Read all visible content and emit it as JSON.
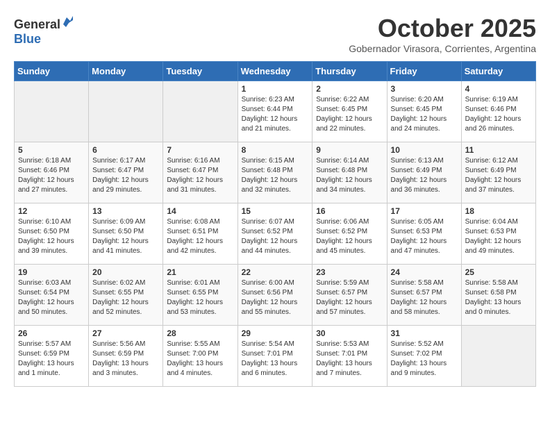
{
  "header": {
    "logo_general": "General",
    "logo_blue": "Blue",
    "month_title": "October 2025",
    "location": "Gobernador Virasora, Corrientes, Argentina"
  },
  "weekdays": [
    "Sunday",
    "Monday",
    "Tuesday",
    "Wednesday",
    "Thursday",
    "Friday",
    "Saturday"
  ],
  "weeks": [
    [
      {
        "day": "",
        "info": ""
      },
      {
        "day": "",
        "info": ""
      },
      {
        "day": "",
        "info": ""
      },
      {
        "day": "1",
        "info": "Sunrise: 6:23 AM\nSunset: 6:44 PM\nDaylight: 12 hours\nand 21 minutes."
      },
      {
        "day": "2",
        "info": "Sunrise: 6:22 AM\nSunset: 6:45 PM\nDaylight: 12 hours\nand 22 minutes."
      },
      {
        "day": "3",
        "info": "Sunrise: 6:20 AM\nSunset: 6:45 PM\nDaylight: 12 hours\nand 24 minutes."
      },
      {
        "day": "4",
        "info": "Sunrise: 6:19 AM\nSunset: 6:46 PM\nDaylight: 12 hours\nand 26 minutes."
      }
    ],
    [
      {
        "day": "5",
        "info": "Sunrise: 6:18 AM\nSunset: 6:46 PM\nDaylight: 12 hours\nand 27 minutes."
      },
      {
        "day": "6",
        "info": "Sunrise: 6:17 AM\nSunset: 6:47 PM\nDaylight: 12 hours\nand 29 minutes."
      },
      {
        "day": "7",
        "info": "Sunrise: 6:16 AM\nSunset: 6:47 PM\nDaylight: 12 hours\nand 31 minutes."
      },
      {
        "day": "8",
        "info": "Sunrise: 6:15 AM\nSunset: 6:48 PM\nDaylight: 12 hours\nand 32 minutes."
      },
      {
        "day": "9",
        "info": "Sunrise: 6:14 AM\nSunset: 6:48 PM\nDaylight: 12 hours\nand 34 minutes."
      },
      {
        "day": "10",
        "info": "Sunrise: 6:13 AM\nSunset: 6:49 PM\nDaylight: 12 hours\nand 36 minutes."
      },
      {
        "day": "11",
        "info": "Sunrise: 6:12 AM\nSunset: 6:49 PM\nDaylight: 12 hours\nand 37 minutes."
      }
    ],
    [
      {
        "day": "12",
        "info": "Sunrise: 6:10 AM\nSunset: 6:50 PM\nDaylight: 12 hours\nand 39 minutes."
      },
      {
        "day": "13",
        "info": "Sunrise: 6:09 AM\nSunset: 6:50 PM\nDaylight: 12 hours\nand 41 minutes."
      },
      {
        "day": "14",
        "info": "Sunrise: 6:08 AM\nSunset: 6:51 PM\nDaylight: 12 hours\nand 42 minutes."
      },
      {
        "day": "15",
        "info": "Sunrise: 6:07 AM\nSunset: 6:52 PM\nDaylight: 12 hours\nand 44 minutes."
      },
      {
        "day": "16",
        "info": "Sunrise: 6:06 AM\nSunset: 6:52 PM\nDaylight: 12 hours\nand 45 minutes."
      },
      {
        "day": "17",
        "info": "Sunrise: 6:05 AM\nSunset: 6:53 PM\nDaylight: 12 hours\nand 47 minutes."
      },
      {
        "day": "18",
        "info": "Sunrise: 6:04 AM\nSunset: 6:53 PM\nDaylight: 12 hours\nand 49 minutes."
      }
    ],
    [
      {
        "day": "19",
        "info": "Sunrise: 6:03 AM\nSunset: 6:54 PM\nDaylight: 12 hours\nand 50 minutes."
      },
      {
        "day": "20",
        "info": "Sunrise: 6:02 AM\nSunset: 6:55 PM\nDaylight: 12 hours\nand 52 minutes."
      },
      {
        "day": "21",
        "info": "Sunrise: 6:01 AM\nSunset: 6:55 PM\nDaylight: 12 hours\nand 53 minutes."
      },
      {
        "day": "22",
        "info": "Sunrise: 6:00 AM\nSunset: 6:56 PM\nDaylight: 12 hours\nand 55 minutes."
      },
      {
        "day": "23",
        "info": "Sunrise: 5:59 AM\nSunset: 6:57 PM\nDaylight: 12 hours\nand 57 minutes."
      },
      {
        "day": "24",
        "info": "Sunrise: 5:58 AM\nSunset: 6:57 PM\nDaylight: 12 hours\nand 58 minutes."
      },
      {
        "day": "25",
        "info": "Sunrise: 5:58 AM\nSunset: 6:58 PM\nDaylight: 13 hours\nand 0 minutes."
      }
    ],
    [
      {
        "day": "26",
        "info": "Sunrise: 5:57 AM\nSunset: 6:59 PM\nDaylight: 13 hours\nand 1 minute."
      },
      {
        "day": "27",
        "info": "Sunrise: 5:56 AM\nSunset: 6:59 PM\nDaylight: 13 hours\nand 3 minutes."
      },
      {
        "day": "28",
        "info": "Sunrise: 5:55 AM\nSunset: 7:00 PM\nDaylight: 13 hours\nand 4 minutes."
      },
      {
        "day": "29",
        "info": "Sunrise: 5:54 AM\nSunset: 7:01 PM\nDaylight: 13 hours\nand 6 minutes."
      },
      {
        "day": "30",
        "info": "Sunrise: 5:53 AM\nSunset: 7:01 PM\nDaylight: 13 hours\nand 7 minutes."
      },
      {
        "day": "31",
        "info": "Sunrise: 5:52 AM\nSunset: 7:02 PM\nDaylight: 13 hours\nand 9 minutes."
      },
      {
        "day": "",
        "info": ""
      }
    ]
  ]
}
